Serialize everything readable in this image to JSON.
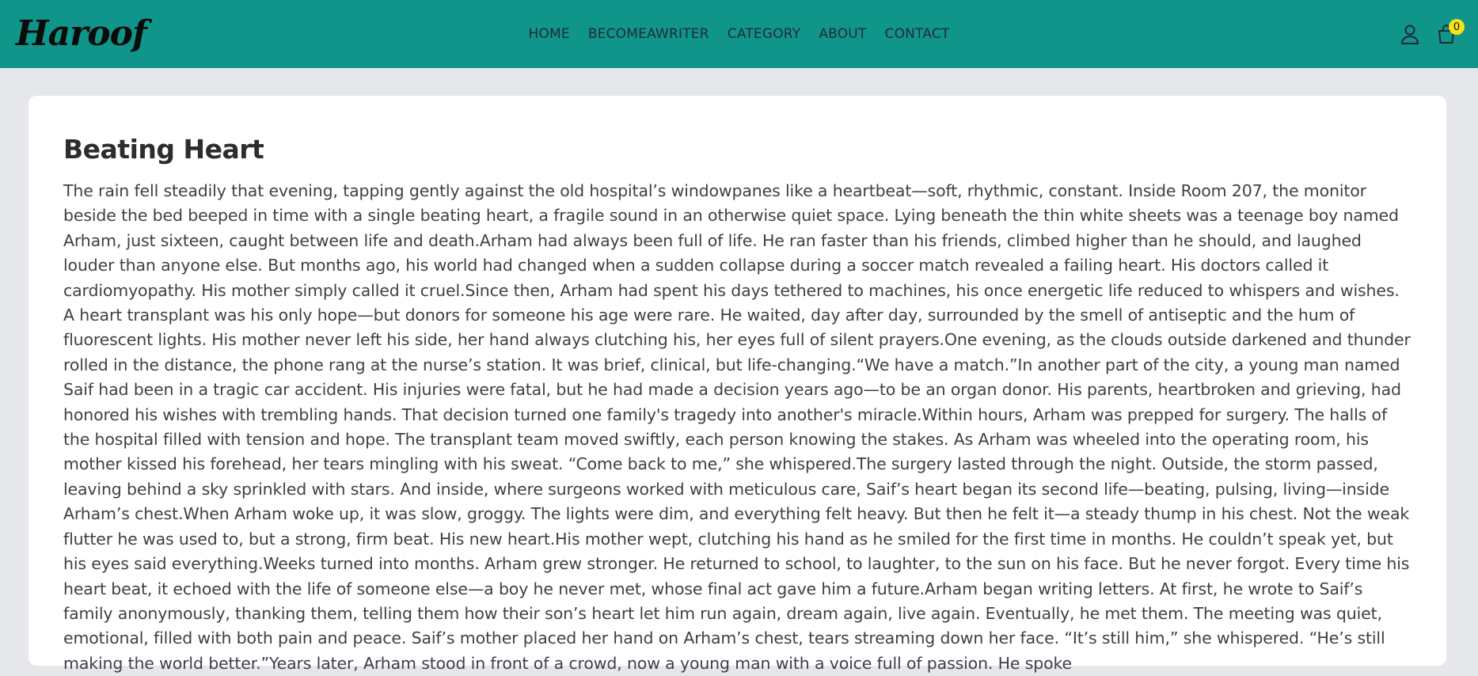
{
  "header": {
    "logo": "Haroof",
    "nav": [
      "HOME",
      "BECOMEAWRITER",
      "CATEGORY",
      "ABOUT",
      "CONTACT"
    ],
    "cart_count": "0",
    "icons": [
      "user-icon",
      "cart-icon"
    ],
    "colors": {
      "bar": "#10958a",
      "badge": "#f8e21c"
    }
  },
  "story": {
    "title": "Beating Heart",
    "body": "The rain fell steadily that evening, tapping gently against the old hospital’s windowpanes like a heartbeat—soft, rhythmic, constant. Inside Room 207, the monitor beside the bed beeped in time with a single beating heart, a fragile sound in an otherwise quiet space. Lying beneath the thin white sheets was a teenage boy named Arham, just sixteen, caught between life and death.Arham had always been full of life. He ran faster than his friends, climbed higher than he should, and laughed louder than anyone else. But months ago, his world had changed when a sudden collapse during a soccer match revealed a failing heart. His doctors called it cardiomyopathy. His mother simply called it cruel.Since then, Arham had spent his days tethered to machines, his once energetic life reduced to whispers and wishes. A heart transplant was his only hope—but donors for someone his age were rare. He waited, day after day, surrounded by the smell of antiseptic and the hum of fluorescent lights. His mother never left his side, her hand always clutching his, her eyes full of silent prayers.One evening, as the clouds outside darkened and thunder rolled in the distance, the phone rang at the nurse’s station. It was brief, clinical, but life-changing.“We have a match.”In another part of the city, a young man named Saif had been in a tragic car accident. His injuries were fatal, but he had made a decision years ago—to be an organ donor. His parents, heartbroken and grieving, had honored his wishes with trembling hands. That decision turned one family's tragedy into another's miracle.Within hours, Arham was prepped for surgery. The halls of the hospital filled with tension and hope. The transplant team moved swiftly, each person knowing the stakes. As Arham was wheeled into the operating room, his mother kissed his forehead, her tears mingling with his sweat. “Come back to me,” she whispered.The surgery lasted through the night. Outside, the storm passed, leaving behind a sky sprinkled with stars. And inside, where surgeons worked with meticulous care, Saif’s heart began its second life—beating, pulsing, living—inside Arham’s chest.When Arham woke up, it was slow, groggy. The lights were dim, and everything felt heavy. But then he felt it—a steady thump in his chest. Not the weak flutter he was used to, but a strong, firm beat. His new heart.His mother wept, clutching his hand as he smiled for the first time in months. He couldn’t speak yet, but his eyes said everything.Weeks turned into months. Arham grew stronger. He returned to school, to laughter, to the sun on his face. But he never forgot. Every time his heart beat, it echoed with the life of someone else—a boy he never met, whose final act gave him a future.Arham began writing letters. At first, he wrote to Saif’s family anonymously, thanking them, telling them how their son’s heart let him run again, dream again, live again. Eventually, he met them. The meeting was quiet, emotional, filled with both pain and peace. Saif’s mother placed her hand on Arham’s chest, tears streaming down her face. “It’s still him,” she whispered. “He’s still making the world better.”Years later, Arham stood in front of a crowd, now a young man with a voice full of passion. He spoke"
  }
}
